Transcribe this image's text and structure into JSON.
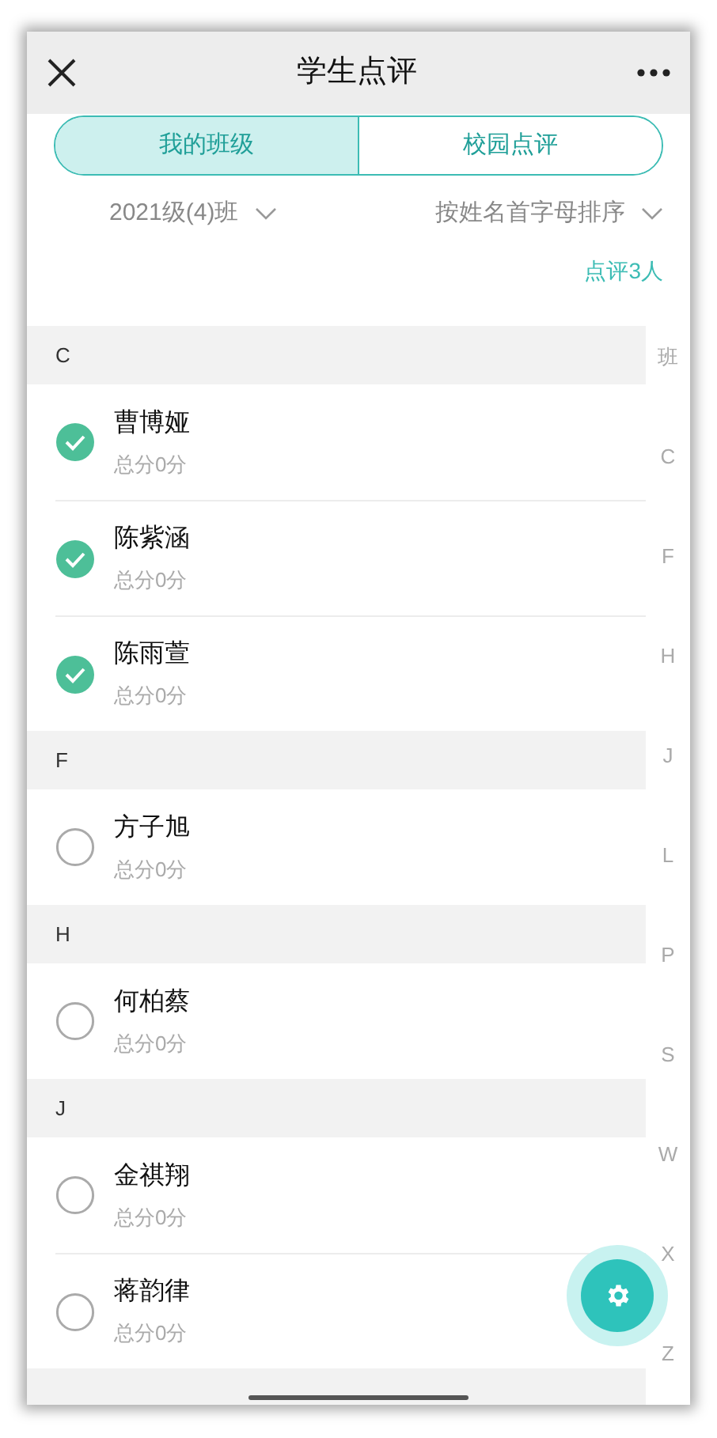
{
  "header": {
    "title": "学生点评"
  },
  "tabs": [
    {
      "label": "我的班级",
      "selected": true
    },
    {
      "label": "校园点评",
      "selected": false
    }
  ],
  "filters": [
    {
      "label": "2021级(4)班"
    },
    {
      "label": "按姓名首字母排序"
    }
  ],
  "review_count": "点评3人",
  "sections": [
    {
      "letter": "C",
      "students": [
        {
          "name": "曹博娅",
          "score": "总分0分",
          "checked": true
        },
        {
          "name": "陈紫涵",
          "score": "总分0分",
          "checked": true
        },
        {
          "name": "陈雨萱",
          "score": "总分0分",
          "checked": true
        }
      ]
    },
    {
      "letter": "F",
      "students": [
        {
          "name": "方子旭",
          "score": "总分0分",
          "checked": false
        }
      ]
    },
    {
      "letter": "H",
      "students": [
        {
          "name": "何柏蔡",
          "score": "总分0分",
          "checked": false
        }
      ]
    },
    {
      "letter": "J",
      "students": [
        {
          "name": "金祺翔",
          "score": "总分0分",
          "checked": false
        },
        {
          "name": "蒋韵律",
          "score": "总分0分",
          "checked": false
        }
      ]
    }
  ],
  "index_bar": [
    "班",
    "C",
    "F",
    "H",
    "J",
    "L",
    "P",
    "S",
    "W",
    "X",
    "Z"
  ]
}
